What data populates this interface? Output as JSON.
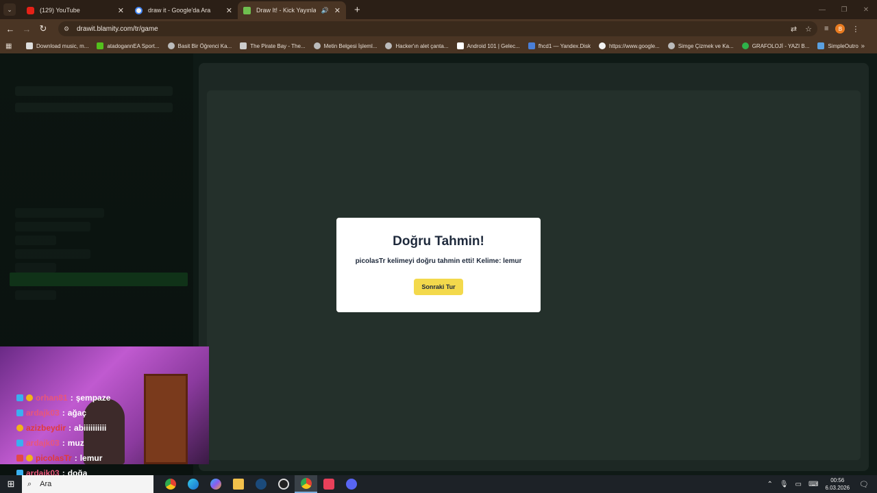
{
  "browser": {
    "tabs": [
      {
        "title": "(129) YouTube",
        "favicon": "youtube-icon",
        "active": false
      },
      {
        "title": "draw it - Google'da Ara",
        "favicon": "google-icon",
        "active": false
      },
      {
        "title": "Draw It! - Kick Yayınları İçin",
        "favicon": "drawit-icon",
        "active": true
      }
    ],
    "url": "drawit.blamity.com/tr/game",
    "profile_initial": "B",
    "bookmarks": [
      "Download music, m...",
      "atadogannEA Sport...",
      "Basit Bir Öğrenci Ka...",
      "The Pirate Bay - The...",
      "Metin Belgesi İşleml...",
      "Hacker'ın alet çanta...",
      "Android 101 | Gelec...",
      "fhcd1 — Yandex.Disk",
      "https://www.google...",
      "Simge Çizmek ve Ka...",
      "GRAFOLOJİ - YAZI B...",
      "SimpleOutro"
    ]
  },
  "modal": {
    "title": "Doğru Tahmin!",
    "message": "picolasTr kelimeyi doğru tahmin etti! Kelime: lemur",
    "next_button": "Sonraki Tur"
  },
  "chat": [
    {
      "user": "orhan81",
      "message": "şempaze",
      "user_color": "pink"
    },
    {
      "user": "ardajk03",
      "message": "ağaç",
      "user_color": "pink"
    },
    {
      "user": "azizbeydir",
      "message": "abiiiiiiiiii",
      "user_color": "pink"
    },
    {
      "user": "ardajk03",
      "message": "muz",
      "user_color": "blue"
    },
    {
      "user": "picolasTr",
      "message": "lemur",
      "user_color": "pink"
    },
    {
      "user": "ardajk03",
      "message": "doğa",
      "user_color": "blue"
    }
  ],
  "taskbar": {
    "search_placeholder": "Ara",
    "time": "00:56",
    "date": "6.03.2026"
  }
}
